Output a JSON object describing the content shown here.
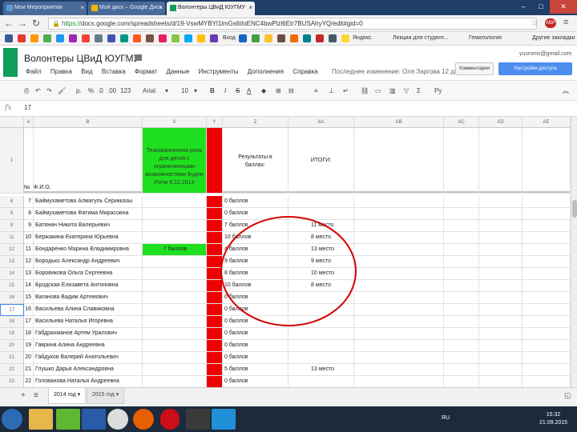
{
  "browser": {
    "tabs": [
      {
        "label": "Мои Мероприятия",
        "favicon_color": "#5c9bd6"
      },
      {
        "label": "Мой диск – Google Диск",
        "favicon_color": "#f4b400"
      },
      {
        "label": "Волонтеры ЦВиД ЮУГМУ",
        "favicon_color": "#0f9d58"
      }
    ],
    "url_scheme": "https://",
    "url_rest": "docs.google.com/spreadsheets/d/19-VswMYBYl1lmGs6iIoENC4bwPlzl6Etr7BUSAhyYQ/edit#gid=0",
    "ext_label": "ABP",
    "bookmarks": [
      "Яндекс",
      "Лекции для студент...",
      "Гематология",
      "Другие закладки"
    ],
    "bookmark_extra": "Вход"
  },
  "sheet": {
    "title": "Волонтеры ЦВиД ЮУГМУ",
    "menu": [
      "Файл",
      "Правка",
      "Вид",
      "Вставка",
      "Формат",
      "Данные",
      "Инструменты",
      "Дополнения",
      "Справка"
    ],
    "last_edit": "Последнее изменение: Оля Заргова 12 дней назад",
    "user_email": "yusroms@gmail.com",
    "comment_label": "Комментарии",
    "share_label": "Настройки доступа",
    "toolbar": {
      "print": "р",
      "currency": "р.",
      "percent": "%",
      "decimals": ".0",
      "dec2": ".00",
      "format_more": "123",
      "font": "Arial",
      "size": "10",
      "bold": "B",
      "italic": "I",
      "strike": "S",
      "textcolor": "A",
      "sigma": "Σ",
      "lang": "Ру"
    },
    "formula_value": "17",
    "col_headers": [
      "A",
      "B",
      "X",
      "Y",
      "Z",
      "AA",
      "AB",
      "AC",
      "AD",
      "AE"
    ],
    "header_row": {
      "row_num": "1",
      "num_label": "№",
      "fio": "Ф.И.О.",
      "green_text": "Тезизванненная роль для детей с ограниченными возможностями Будни Ритм 6.12.2014",
      "results": "Результаты в баллах:",
      "itogi": "ИТОГИ:"
    },
    "rows": [
      {
        "rn": "6",
        "num": "7",
        "name": "Баймухаметова Алмагуль Серикказы",
        "green": "",
        "score": "0 баллов",
        "place": ""
      },
      {
        "rn": "8",
        "num": "8",
        "name": "Баймухаметова Фатима Мирасовна",
        "green": "",
        "score": "0 баллов",
        "place": ""
      },
      {
        "rn": "9",
        "num": "9",
        "name": "Батянин Никита Валерьевич",
        "green": "",
        "score": "7 баллов",
        "place": "11 место"
      },
      {
        "rn": "11",
        "num": "10",
        "name": "Бержакина Екатерина Юрьевна",
        "green": "",
        "score": "10 баллов",
        "place": "8 место"
      },
      {
        "rn": "12",
        "num": "11",
        "name": "Бондаренко Марина Владимировна",
        "green": "7 баллов",
        "score": "4 баллов",
        "place": "13 место"
      },
      {
        "rn": "13",
        "num": "12",
        "name": "Бородько Александр Андреевич",
        "green": "",
        "score": "9 баллов",
        "place": "9 место"
      },
      {
        "rn": "14",
        "num": "13",
        "name": "Боровикова Ольга Сергеевна",
        "green": "",
        "score": "8 баллов",
        "place": "10 место"
      },
      {
        "rn": "15",
        "num": "14",
        "name": "Бродская Елизавета Антоновна",
        "green": "",
        "score": "10 баллов",
        "place": "8 место"
      },
      {
        "rn": "16",
        "num": "15",
        "name": "Ваганова Вадим Артемович",
        "green": "",
        "score": "0 баллов",
        "place": ""
      },
      {
        "rn": "17",
        "num": "16",
        "name": "Васильева Алина Славиковна",
        "green": "",
        "score": "0 баллов",
        "place": ""
      },
      {
        "rn": "18",
        "num": "17",
        "name": "Васильева Наталья Игоревна",
        "green": "",
        "score": "0 баллов",
        "place": ""
      },
      {
        "rn": "19",
        "num": "18",
        "name": "Габдрахманов Артем Уралович",
        "green": "",
        "score": "0 баллов",
        "place": ""
      },
      {
        "rn": "20",
        "num": "19",
        "name": "Гаврина Алина Андреевна",
        "green": "",
        "score": "0 баллов",
        "place": ""
      },
      {
        "rn": "21",
        "num": "20",
        "name": "Гайдуков Валерий Анатольевич",
        "green": "",
        "score": "0 баллов",
        "place": ""
      },
      {
        "rn": "22",
        "num": "21",
        "name": "Глушко Дарья Александровна",
        "green": "",
        "score": "5 баллов",
        "place": "13 место"
      },
      {
        "rn": "23",
        "num": "22",
        "name": "Голованова Наталья Андреевна",
        "green": "",
        "score": "0 баллов",
        "place": ""
      }
    ],
    "sheet_tabs": [
      "2014 год",
      "2015 год"
    ],
    "annotation_color": "#d40000"
  },
  "taskbar": {
    "lang": "RU",
    "time": "15:32",
    "date": "21.09.2015"
  }
}
